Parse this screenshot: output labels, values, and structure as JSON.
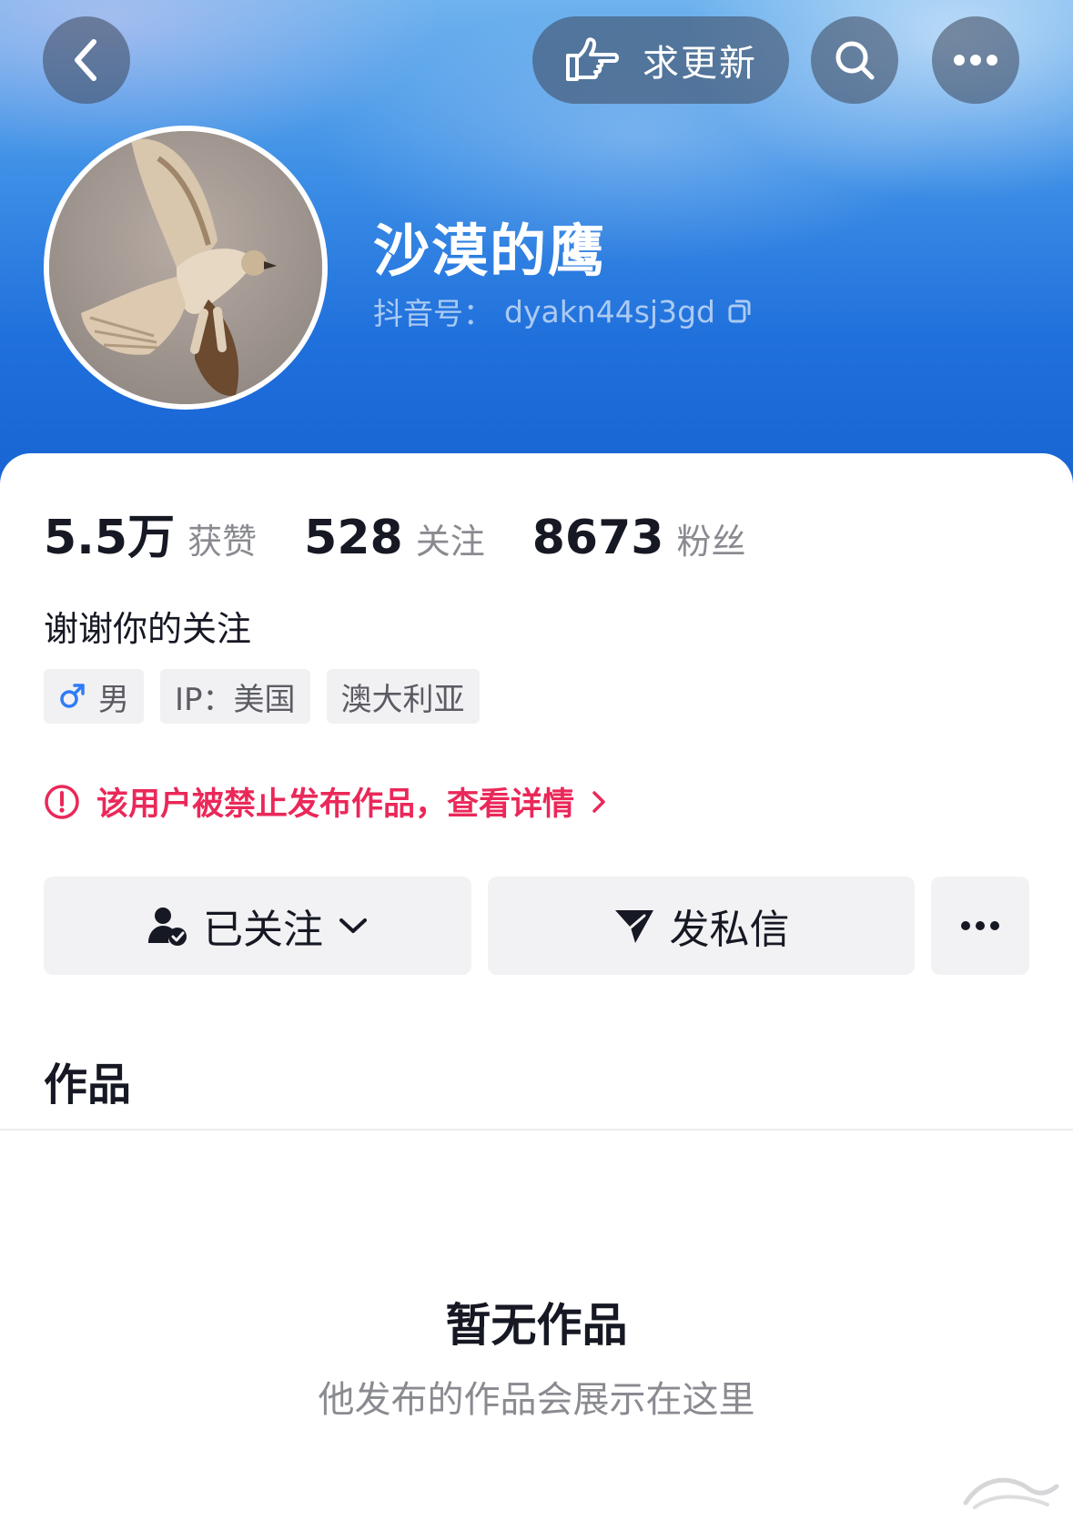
{
  "header": {
    "request_update_label": "求更新",
    "nickname": "沙漠的鹰",
    "douyin_id_label": "抖音号：",
    "douyin_id_value": "dyakn44sj3gd"
  },
  "stats": {
    "likes_value": "5.5万",
    "likes_label": "获赞",
    "following_value": "528",
    "following_label": "关注",
    "followers_value": "8673",
    "followers_label": "粉丝"
  },
  "bio": "谢谢你的关注",
  "tags": {
    "gender_label": "男",
    "ip_label": "IP：美国",
    "location_label": "澳大利亚"
  },
  "notice": {
    "text": "该用户被禁止发布作品，查看详情",
    "color": "#ea2859"
  },
  "actions": {
    "followed_label": "已关注",
    "message_label": "发私信"
  },
  "tabs": {
    "works_label": "作品"
  },
  "empty_state": {
    "title": "暂无作品",
    "subtitle": "他发布的作品会展示在这里"
  },
  "icons": {
    "back": "back-chevron-icon",
    "hand": "pointing-hand-icon",
    "search": "search-icon",
    "more": "more-dots-icon",
    "copy": "copy-icon",
    "male": "male-icon",
    "warning": "warning-circle-icon",
    "user_check": "user-check-icon",
    "send": "paper-plane-icon"
  }
}
